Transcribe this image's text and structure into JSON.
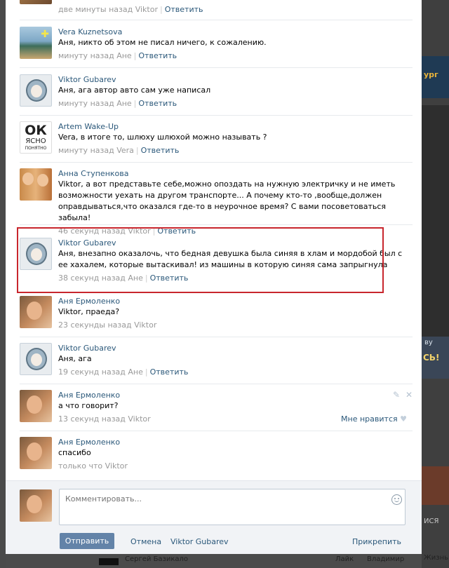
{
  "comments": [
    {
      "author": "",
      "text": "",
      "meta_time": "две минуты назад Viktor",
      "reply": "Ответить"
    },
    {
      "author": "Vera Kuznetsova",
      "text": "Аня, никто об этом не писал ничего, к сожалению.",
      "meta_time": "минуту назад Ане",
      "reply": "Ответить"
    },
    {
      "author": "Viktor Gubarev",
      "text": "Аня, ага автор авто сам уже написал",
      "meta_time": "минуту назад Ане",
      "reply": "Ответить"
    },
    {
      "author": "Artem Wake-Up",
      "text": "Vera, в итоге то, шлюху шлюхой можно называть ?",
      "meta_time": "минуту назад Vera",
      "reply": "Ответить",
      "avatar_lines": [
        "ОК",
        "ЯСНО",
        "ПОНЯТНО"
      ]
    },
    {
      "author": "Анна Ступенкова",
      "text": "Viktor, а вот представьте себе,можно опоздать на нужную электричку и не иметь возможности уехать на другом транспорте... А почему кто-то ,вообще,должен оправдываться,что оказался где-то в неурочное время? С вами посоветоваться забыла!",
      "meta_time": "46 секунд назад Viktor",
      "reply": "Ответить"
    },
    {
      "author": "Viktor Gubarev",
      "text": "Аня, внезапно оказалочь, что бедная девушка была синяя в хлам и мордобой был с ее хахалем, которые вытаскивал! из машины в которую синяя сама запрыгнула",
      "meta_time": "38 секунд назад Ане",
      "reply": "Ответить"
    },
    {
      "author": "Аня Ермоленко",
      "text": "Viktor, праеда?",
      "meta_time": "23 секунды назад Viktor",
      "reply": ""
    },
    {
      "author": "Viktor Gubarev",
      "text": "Аня, ага",
      "meta_time": "19 секунд назад Ане",
      "reply": "Ответить"
    },
    {
      "author": "Аня Ермоленко",
      "text": "а что говорит?",
      "meta_time": "13 секунд назад Viktor",
      "reply": "",
      "like": "Мне нравится"
    },
    {
      "author": "Аня Ермоленко",
      "text": "спасибо",
      "meta_time": "только что Viktor",
      "reply": ""
    }
  ],
  "composer": {
    "placeholder": "Комментировать...",
    "send": "Отправить",
    "cancel": "Отмена",
    "reply_to": "Viktor Gubarev",
    "attach": "Прикрепить"
  },
  "background": {
    "right_texts": [
      "ург",
      "ву",
      "СЬ!",
      "ИСЯ",
      "Жизнь"
    ],
    "bottom_texts": [
      "Сергей Базикало",
      "Лайк",
      "Владимир"
    ]
  },
  "colors": {
    "link": "#2b587a",
    "accent": "#6383a8",
    "highlight": "#c8262d"
  }
}
